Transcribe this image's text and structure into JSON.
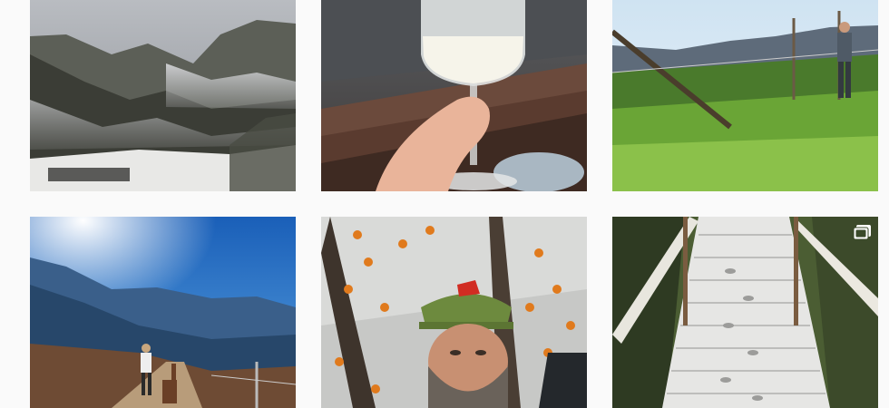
{
  "feed": {
    "posts": [
      {
        "name": "photo-misty-valley",
        "type": "image"
      },
      {
        "name": "photo-wine-glass",
        "type": "image"
      },
      {
        "name": "photo-vineyard-man",
        "type": "image"
      },
      {
        "name": "photo-alpaca-hike",
        "type": "image"
      },
      {
        "name": "photo-snowy-portrait",
        "type": "image"
      },
      {
        "name": "photo-snowy-bridge",
        "type": "carousel",
        "badge_icon": "carousel-icon"
      }
    ]
  },
  "colors": {
    "background": "#fafafa"
  }
}
